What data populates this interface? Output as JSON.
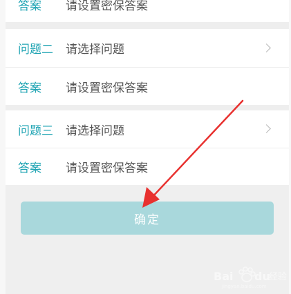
{
  "rows": [
    {
      "label": "答案",
      "value": "请设置密保答案"
    },
    {
      "label": "问题二",
      "value": "请选择问题"
    },
    {
      "label": "答案",
      "value": "请设置密保答案"
    },
    {
      "label": "问题三",
      "value": "请选择问题"
    },
    {
      "label": "答案",
      "value": "请设置密保答案"
    }
  ],
  "confirm_label": "确定",
  "colors": {
    "label": "#22a5b4",
    "button": "#a9d8dc",
    "arrow": "#e8312f"
  }
}
